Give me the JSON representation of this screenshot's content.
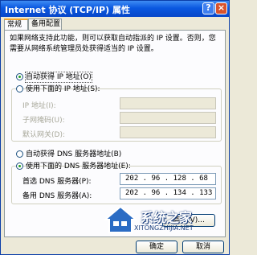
{
  "window": {
    "title": "Internet 协议 (TCP/IP) 属性",
    "help_button": "?",
    "close_button": "×"
  },
  "tabs": [
    {
      "label": "常规",
      "active": true
    },
    {
      "label": "备用配置",
      "active": false
    }
  ],
  "description": "如果网络支持此功能，则可以获取自动指派的 IP 设置。否则，您需要从网络系统管理员处获得适当的 IP 设置。",
  "ip": {
    "auto_label": "自动获得 IP 地址(O)",
    "auto_checked": true,
    "manual_label": "使用下面的 IP 地址(S):",
    "manual_checked": false,
    "fields": [
      {
        "label": "IP 地址(I):",
        "value": ""
      },
      {
        "label": "子网掩码(U):",
        "value": ""
      },
      {
        "label": "默认网关(D):",
        "value": ""
      }
    ]
  },
  "dns": {
    "auto_label": "自动获得 DNS 服务器地址(B)",
    "auto_checked": false,
    "manual_label": "使用下面的 DNS 服务器地址(E):",
    "manual_checked": true,
    "preferred_label": "首选 DNS 服务器(P):",
    "preferred_value": "202 . 96 . 128 . 68",
    "alternate_label": "备用 DNS 服务器(A):",
    "alternate_value": "202 . 96 . 134 . 133"
  },
  "footer": {
    "advanced_label": "高级(V)...",
    "ok_label": "确定",
    "cancel_label": "取消"
  },
  "watermark": {
    "text": "系统之家",
    "url": "XITONGZHIJIA.NET"
  },
  "colors": {
    "titlebar": "#0a58e0",
    "tab_highlight": "#f2a62e",
    "radio_dot": "#21a121"
  }
}
